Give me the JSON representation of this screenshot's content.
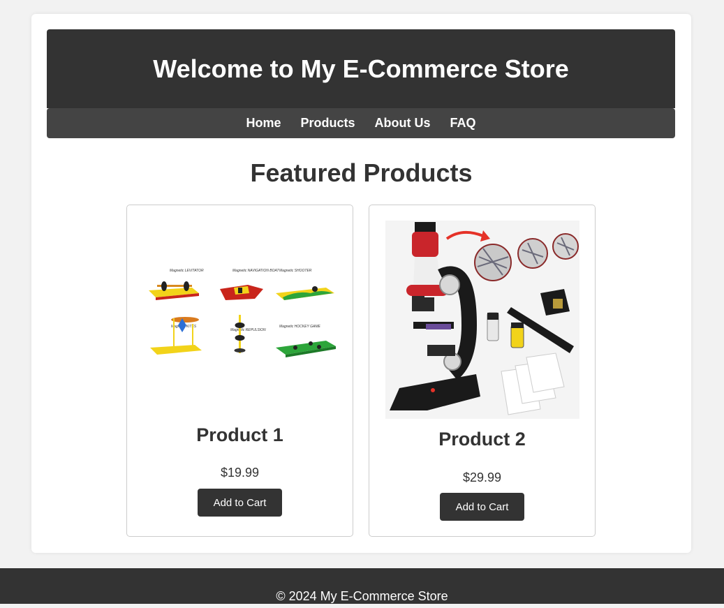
{
  "header": {
    "title": "Welcome to My E-Commerce Store"
  },
  "nav": {
    "items": [
      {
        "label": "Home"
      },
      {
        "label": "Products"
      },
      {
        "label": "About Us"
      },
      {
        "label": "FAQ"
      }
    ]
  },
  "main": {
    "section_title": "Featured Products",
    "products": [
      {
        "name": "Product 1",
        "price": "$19.99",
        "button_label": "Add to Cart",
        "image_labels": [
          "Magnetic LEVITATOR",
          "Magnetic NAVIGATION BOAT",
          "Magnetic SHOOTER",
          "Magnetic KITES",
          "Magnetic REPULSION",
          "Magnetic HOCKEY GAME"
        ]
      },
      {
        "name": "Product 2",
        "price": "$29.99",
        "button_label": "Add to Cart"
      }
    ]
  },
  "footer": {
    "text": "© 2024 My E-Commerce Store"
  },
  "colors": {
    "header_bg": "#333333",
    "nav_bg": "#444444",
    "button_bg": "#333333",
    "page_bg": "#f2f2f2"
  }
}
